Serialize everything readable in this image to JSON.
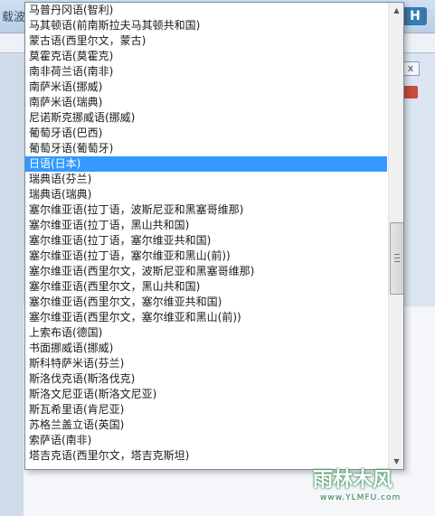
{
  "background_window": {
    "title_fragment": "载波",
    "logo_letter": "H",
    "pane_close": "x"
  },
  "dropdown": {
    "selected_index": 10,
    "items": [
      "马普丹冈语(智利)",
      "马其顿语(前南斯拉夫马其顿共和国)",
      "蒙古语(西里尔文，蒙古)",
      "莫霍克语(莫霍克)",
      "南非荷兰语(南非)",
      "南萨米语(挪威)",
      "南萨米语(瑞典)",
      "尼诺斯克挪威语(挪威)",
      "葡萄牙语(巴西)",
      "葡萄牙语(葡萄牙)",
      "日语(日本)",
      "瑞典语(芬兰)",
      "瑞典语(瑞典)",
      "塞尔维亚语(拉丁语，波斯尼亚和黑塞哥维那)",
      "塞尔维亚语(拉丁语，黑山共和国)",
      "塞尔维亚语(拉丁语，塞尔维亚共和国)",
      "塞尔维亚语(拉丁语，塞尔维亚和黑山(前))",
      "塞尔维亚语(西里尔文，波斯尼亚和黑塞哥维那)",
      "塞尔维亚语(西里尔文，黑山共和国)",
      "塞尔维亚语(西里尔文，塞尔维亚共和国)",
      "塞尔维亚语(西里尔文，塞尔维亚和黑山(前))",
      "上索布语(德国)",
      "书面挪威语(挪威)",
      "斯科特萨米语(芬兰)",
      "斯洛伐克语(斯洛伐克)",
      "斯洛文尼亚语(斯洛文尼亚)",
      "斯瓦希里语(肯尼亚)",
      "苏格兰盖立语(英国)",
      "索萨语(南非)",
      "塔吉克语(西里尔文，塔吉克斯坦)"
    ],
    "scroll_up_icon": "triangle-up-icon",
    "scroll_down_icon": "triangle-down-icon"
  },
  "watermark": {
    "logo_text": "雨林木风",
    "url": "www.YLMFU.com"
  },
  "colors": {
    "selection": "#3399ff",
    "text": "#1a1a1a"
  }
}
